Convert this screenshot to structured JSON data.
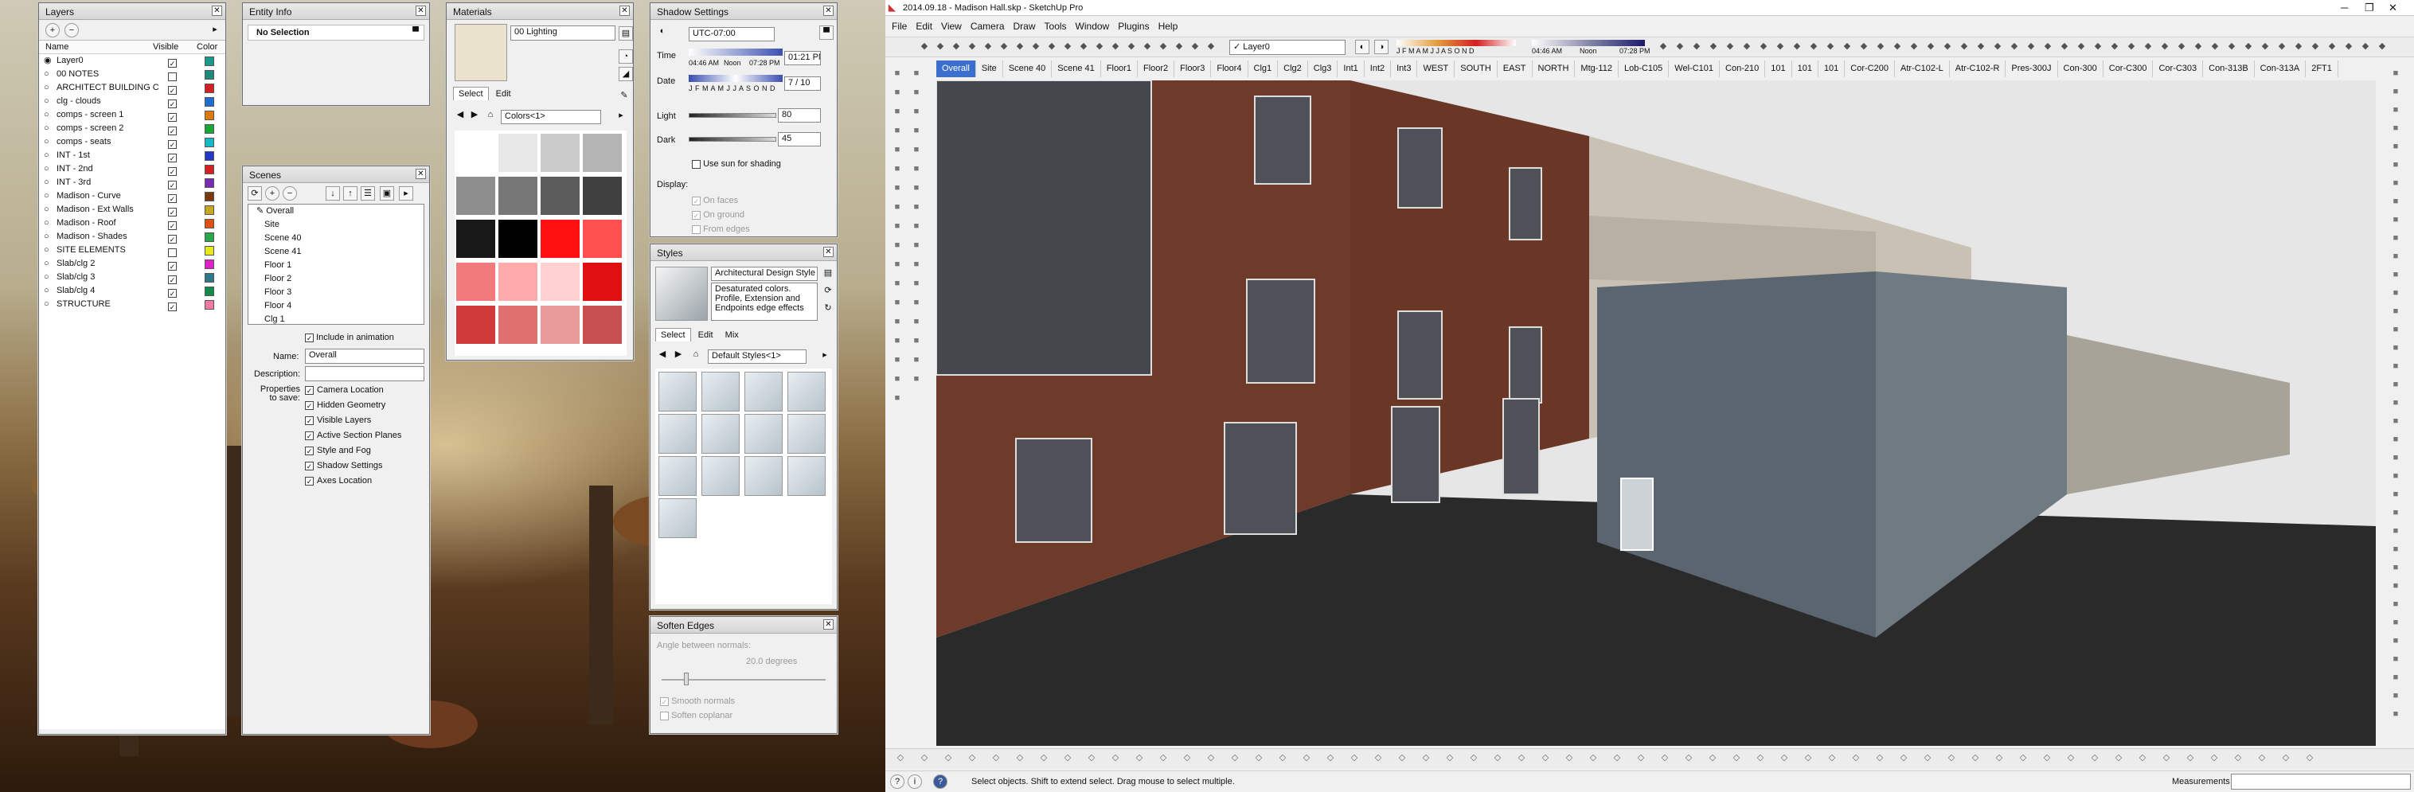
{
  "layers": {
    "title": "Layers",
    "col_name": "Name",
    "col_visible": "Visible",
    "col_color": "Color",
    "rows": [
      {
        "name": "Layer0",
        "color": "#1a9a8a"
      },
      {
        "name": "00 NOTES",
        "color": "#1d8a7c"
      },
      {
        "name": "ARCHITECT BUILDING C",
        "color": "#d42020"
      },
      {
        "name": "clg - clouds",
        "color": "#1c6fd0"
      },
      {
        "name": "comps - screen 1",
        "color": "#e07a10"
      },
      {
        "name": "comps - screen 2",
        "color": "#18a838"
      },
      {
        "name": "comps - seats",
        "color": "#18b8c8"
      },
      {
        "name": "INT - 1st",
        "color": "#2438c8"
      },
      {
        "name": "INT - 2nd",
        "color": "#d42020"
      },
      {
        "name": "INT - 3rd",
        "color": "#7a2ab0"
      },
      {
        "name": "Madison - Curve",
        "color": "#7a3a10"
      },
      {
        "name": "Madison - Ext Walls",
        "color": "#c8a820"
      },
      {
        "name": "Madison - Roof",
        "color": "#e05010"
      },
      {
        "name": "Madison - Shades",
        "color": "#28a848"
      },
      {
        "name": "SITE ELEMENTS",
        "color": "#e8e820"
      },
      {
        "name": "Slab/clg 2",
        "color": "#e020c8"
      },
      {
        "name": "Slab/clg 3",
        "color": "#2a7a8a"
      },
      {
        "name": "Slab/clg 4",
        "color": "#128a4a"
      },
      {
        "name": "STRUCTURE",
        "color": "#f07aa0"
      }
    ]
  },
  "entity": {
    "title": "Entity Info",
    "selection": "No Selection"
  },
  "scenes": {
    "title": "Scenes",
    "items": [
      "Overall",
      "Site",
      "Scene 40",
      "Scene 41",
      "Floor 1",
      "Floor 2",
      "Floor 3",
      "Floor 4",
      "Clg 1"
    ],
    "include_label": "Include in animation",
    "name_label": "Name:",
    "name_value": "Overall",
    "desc_label": "Description:",
    "props_label": "Properties to save:",
    "props": [
      "Camera Location",
      "Hidden Geometry",
      "Visible Layers",
      "Active Section Planes",
      "Style and Fog",
      "Shadow Settings",
      "Axes Location"
    ]
  },
  "materials": {
    "title": "Materials",
    "name": "00 Lighting",
    "tab_select": "Select",
    "tab_edit": "Edit",
    "collection": "Colors<1>",
    "swatches": [
      "#ffffff",
      "#e7e7e7",
      "#cbcbcb",
      "#b4b4b4",
      "#8e8e8e",
      "#777777",
      "#5c5c5c",
      "#404040",
      "#181818",
      "#000000",
      "#ff1010",
      "#ff5050",
      "#f27a7a",
      "#ffaaaa",
      "#ffd0d0",
      "#e01010",
      "#d03a3a",
      "#e07070",
      "#e89a9a",
      "#c85050"
    ]
  },
  "shadows": {
    "title": "Shadow Settings",
    "tz": "UTC-07:00",
    "time_label": "Time",
    "time_start": "04:46 AM",
    "time_noon": "Noon",
    "time_end": "07:28 PM",
    "time_value": "01:21 PM",
    "date_label": "Date",
    "months": "J F M A M J J A S O N D",
    "date_value": "7 / 10",
    "light_label": "Light",
    "light_value": "80",
    "dark_label": "Dark",
    "dark_value": "45",
    "use_sun": "Use sun for shading",
    "display_label": "Display:",
    "on_faces": "On faces",
    "on_ground": "On ground",
    "from_edges": "From edges"
  },
  "styles": {
    "title": "Styles",
    "style_name": "Architectural Design Style",
    "desc": "Desaturated colors. Profile, Extension and Endpoints edge effects",
    "tab_select": "Select",
    "tab_edit": "Edit",
    "tab_mix": "Mix",
    "collection": "Default Styles<1>"
  },
  "soften": {
    "title": "Soften Edges",
    "angle_label": "Angle between normals:",
    "angle_value": "20.0  degrees",
    "smooth": "Smooth normals",
    "coplanar": "Soften coplanar"
  },
  "app": {
    "title": "2014.09.18 - Madison Hall.skp - SketchUp Pro",
    "menus": [
      "File",
      "Edit",
      "View",
      "Camera",
      "Draw",
      "Tools",
      "Window",
      "Plugins",
      "Help"
    ],
    "layer_select": "Layer0",
    "shadow_months": "J F M A M J J A S O N D",
    "shadow_start": "04:46 AM",
    "shadow_noon": "Noon",
    "shadow_end": "07:28 PM",
    "scene_tabs": [
      "Overall",
      "Site",
      "Scene 40",
      "Scene 41",
      "Floor1",
      "Floor2",
      "Floor3",
      "Floor4",
      "Clg1",
      "Clg2",
      "Clg3",
      "Int1",
      "Int2",
      "Int3",
      "WEST",
      "SOUTH",
      "EAST",
      "NORTH",
      "Mtg-112",
      "Lob-C105",
      "Wel-C101",
      "Con-210",
      "101",
      "101",
      "101",
      "Cor-C200",
      "Atr-C102-L",
      "Atr-C102-R",
      "Pres-300J",
      "Con-300",
      "Cor-C300",
      "Cor-C303",
      "Con-313B",
      "Con-313A",
      "2FT1"
    ],
    "status": "Select objects. Shift to extend select. Drag mouse to select multiple.",
    "measurements": "Measurements"
  }
}
